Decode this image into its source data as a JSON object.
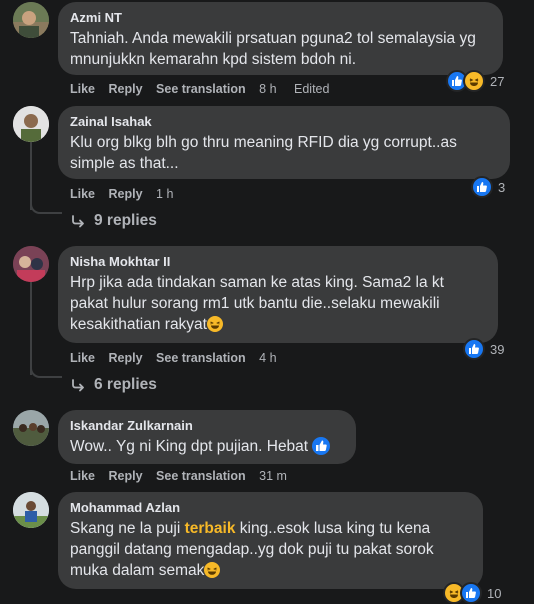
{
  "actions": {
    "like": "Like",
    "reply": "Reply",
    "see_translation": "See translation"
  },
  "comments": [
    {
      "author": "Azmi NT",
      "text": "Tahniah. Anda mewakili prsatuan pguna2 tol semalaysia yg mnunjukkn kemarahn kpd sistem bdoh ni.",
      "time": "8 h",
      "edited": "Edited",
      "reaction_count": "27",
      "reactions": [
        "like-icon",
        "haha-icon"
      ]
    },
    {
      "author": "Zainal Isahak",
      "text": "Klu org blkg blh go thru meaning RFID dia yg corrupt..as simple as that...",
      "time": "1 h",
      "reaction_count": "3",
      "reactions": [
        "like-icon"
      ],
      "replies_label": "9 replies"
    },
    {
      "author": "Nisha Mokhtar II",
      "text": "Hrp jika ada tindakan saman ke atas king. Sama2 la kt pakat hulur sorang rm1 utk bantu die..selaku mewakili kesakithatian rakyat",
      "time": "4 h",
      "reaction_count": "39",
      "reactions": [
        "like-icon"
      ],
      "replies_label": "6 replies"
    },
    {
      "author": "Iskandar Zulkarnain",
      "text": "Wow.. Yg ni King dpt pujian. Hebat",
      "time": "31 m",
      "reactions": []
    },
    {
      "author": "Mohammad Azlan",
      "text_before": "Skang ne la puji ",
      "text_highlight": "terbaik",
      "text_after": " king..esok lusa king tu kena panggil datang mengadap..yg dok puji tu pakat sorok muka dalam semak",
      "reaction_count": "10",
      "reactions": [
        "haha-icon",
        "like-icon"
      ]
    }
  ],
  "colors": {
    "background": "#18191a",
    "bubble": "#3a3b3c",
    "like": "#1877f2",
    "haha": "#f7b928",
    "muted": "#b0b3b8"
  }
}
